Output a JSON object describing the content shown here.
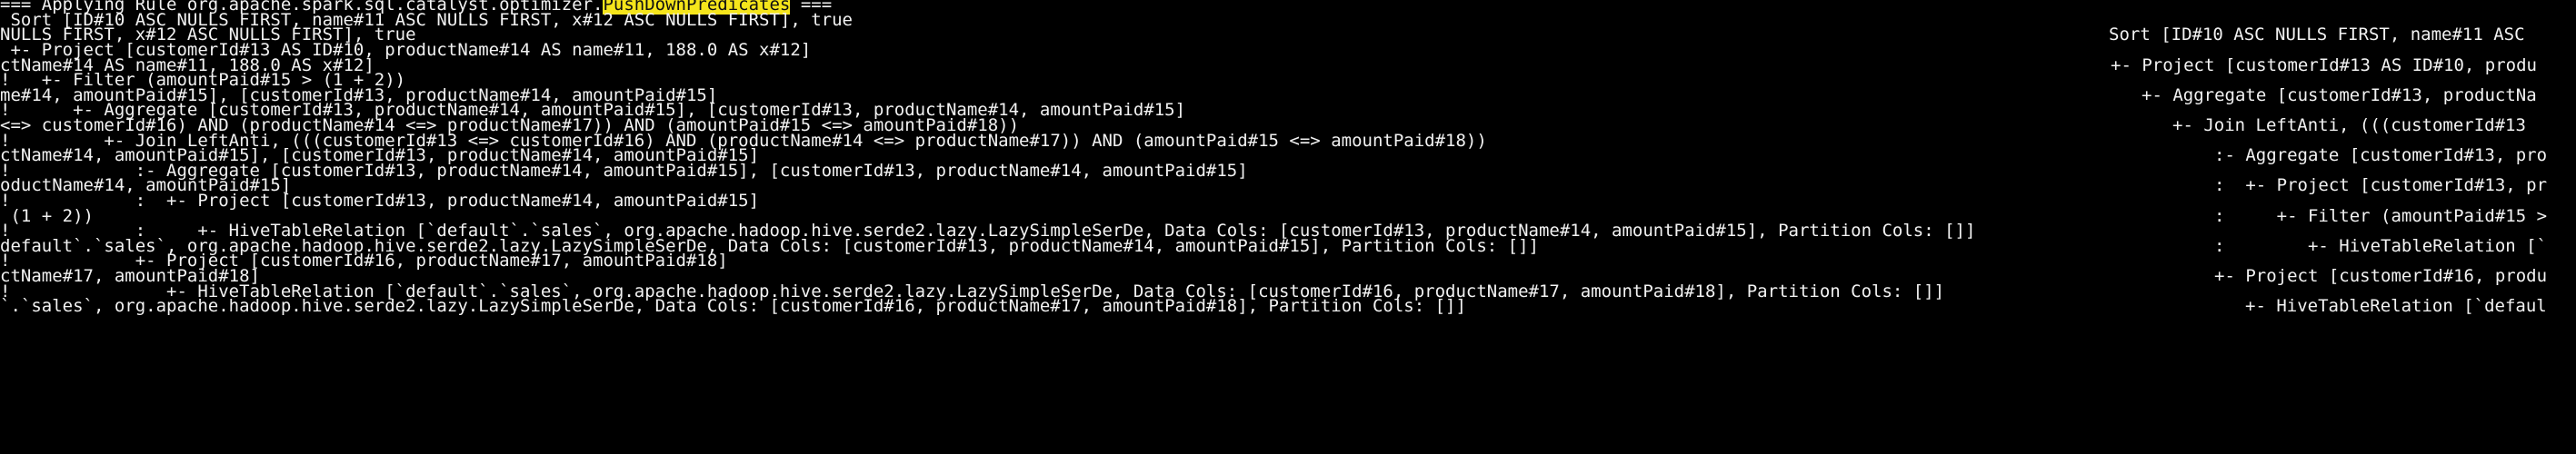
{
  "theme": {
    "background": "#000000",
    "foreground": "#f2f2f2",
    "highlight_bg": "#f5e51b",
    "highlight_fg": "#111111"
  },
  "header": {
    "prefix": "=== Applying Rule org.apache.spark.sql.catalyst.optimizer.",
    "rule_name": "PushDownPredicates",
    "suffix": " ==="
  },
  "left_lines": [
    " Sort [ID#10 ASC NULLS FIRST, name#11 ASC NULLS FIRST, x#12 ASC NULLS FIRST], true",
    "NULLS FIRST, x#12 ASC NULLS FIRST], true",
    " +- Project [customerId#13 AS ID#10, productName#14 AS name#11, 188.0 AS x#12]",
    "ctName#14 AS name#11, 188.0 AS x#12]",
    "!   +- Filter (amountPaid#15 > (1 + 2))",
    "me#14, amountPaid#15], [customerId#13, productName#14, amountPaid#15]",
    "!      +- Aggregate [customerId#13, productName#14, amountPaid#15], [customerId#13, productName#14, amountPaid#15]",
    "<=> customerId#16) AND (productName#14 <=> productName#17)) AND (amountPaid#15 <=> amountPaid#18))",
    "!         +- Join LeftAnti, (((customerId#13 <=> customerId#16) AND (productName#14 <=> productName#17)) AND (amountPaid#15 <=> amountPaid#18))",
    "ctName#14, amountPaid#15], [customerId#13, productName#14, amountPaid#15]",
    "!            :- Aggregate [customerId#13, productName#14, amountPaid#15], [customerId#13, productName#14, amountPaid#15]",
    "oductName#14, amountPaid#15]",
    "!            :  +- Project [customerId#13, productName#14, amountPaid#15]",
    " (1 + 2))",
    "!            :     +- HiveTableRelation [`default`.`sales`, org.apache.hadoop.hive.serde2.lazy.LazySimpleSerDe, Data Cols: [customerId#13, productName#14, amountPaid#15], Partition Cols: []]",
    "default`.`sales`, org.apache.hadoop.hive.serde2.lazy.LazySimpleSerDe, Data Cols: [customerId#13, productName#14, amountPaid#15], Partition Cols: []]",
    "!            +- Project [customerId#16, productName#17, amountPaid#18]",
    "ctName#17, amountPaid#18]",
    "!               +- HiveTableRelation [`default`.`sales`, org.apache.hadoop.hive.serde2.lazy.LazySimpleSerDe, Data Cols: [customerId#16, productName#17, amountPaid#18], Partition Cols: []]",
    "`.`sales`, org.apache.hadoop.hive.serde2.lazy.LazySimpleSerDe, Data Cols: [customerId#16, productName#17, amountPaid#18], Partition Cols: []]"
  ],
  "right_lines": [
    "",
    "Sort [ID#10 ASC NULLS FIRST, name#11 ASC",
    "",
    "+- Project [customerId#13 AS ID#10, produ",
    "",
    "+- Aggregate [customerId#13, productNa",
    "",
    "+- Join LeftAnti, (((customerId#13",
    "",
    ":- Aggregate [customerId#13, pro",
    "",
    ":  +- Project [customerId#13, pr",
    "",
    ":     +- Filter (amountPaid#15 >",
    "",
    ":        +- HiveTableRelation [`",
    "",
    "+- Project [customerId#16, produ",
    "",
    "+- HiveTableRelation [`defaul"
  ]
}
